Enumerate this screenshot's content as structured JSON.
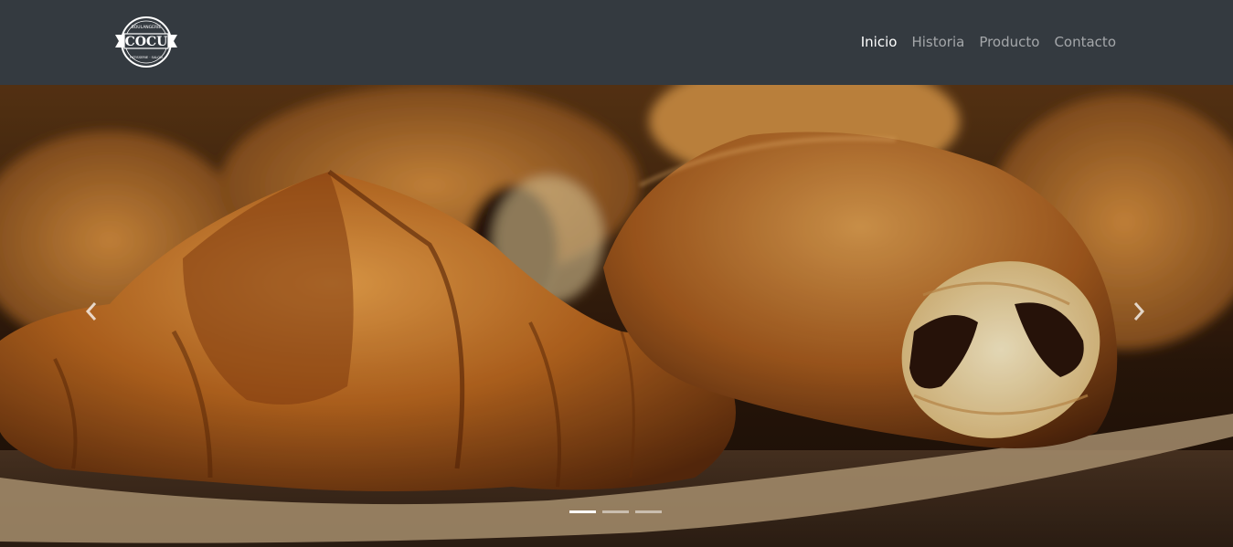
{
  "brand": {
    "name": "COCU",
    "ring_text_top": "BOULANGERIE",
    "ring_text_bottom": "PATISSERIE · SALON"
  },
  "nav": {
    "items": [
      {
        "label": "Inicio",
        "active": true
      },
      {
        "label": "Historia",
        "active": false
      },
      {
        "label": "Producto",
        "active": false
      },
      {
        "label": "Contacto",
        "active": false
      }
    ]
  },
  "carousel": {
    "slide_count": 3,
    "active_slide": 1,
    "image_subject": "croissants and pain au chocolat on parchment",
    "prev_icon": "chevron-left-icon",
    "next_icon": "chevron-right-icon"
  },
  "colors": {
    "navbar": "#343a40",
    "nav_active": "#ffffff",
    "nav_inactive": "#a5a8ab"
  }
}
